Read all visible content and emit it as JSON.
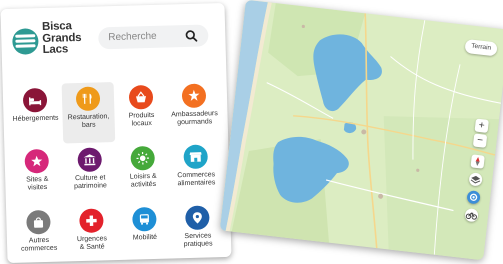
{
  "brand": {
    "line1": "Bisca",
    "line2": "Grands",
    "line3": "Lacs"
  },
  "search": {
    "placeholder": "Recherche"
  },
  "categories": [
    {
      "label": "Hébergements",
      "color": "#8a1538",
      "icon": "bed-icon"
    },
    {
      "label": "Restauration,\nbars",
      "color": "#ef9a1a",
      "icon": "restaurant-icon",
      "active": true
    },
    {
      "label": "Produits\nlocaux",
      "color": "#e84a1c",
      "icon": "basket-icon"
    },
    {
      "label": "Ambassadeurs\ngourmands",
      "color": "#f37021",
      "icon": "star-burst-icon"
    },
    {
      "label": "Sites &\nvisites",
      "color": "#d6287a",
      "icon": "star-icon"
    },
    {
      "label": "Culture et\npatrimoine",
      "color": "#6d1a6e",
      "icon": "museum-icon"
    },
    {
      "label": "Loisirs &\nactivités",
      "color": "#45a93a",
      "icon": "sun-icon"
    },
    {
      "label": "Commerces\nalimentaires",
      "color": "#1fa4c8",
      "icon": "shop-icon"
    },
    {
      "label": "Autres\ncommerces",
      "color": "#7a7a7a",
      "icon": "bag-icon"
    },
    {
      "label": "Urgences\n& Santé",
      "color": "#e3222b",
      "icon": "health-cross-icon"
    },
    {
      "label": "Mobilité",
      "color": "#1e8fd6",
      "icon": "bus-icon"
    },
    {
      "label": "Services\npratiques",
      "color": "#1f5fa8",
      "icon": "map-pin-icon"
    }
  ],
  "map": {
    "terrain_label": "Terrain",
    "zoom_in": "+",
    "zoom_out": "−"
  }
}
